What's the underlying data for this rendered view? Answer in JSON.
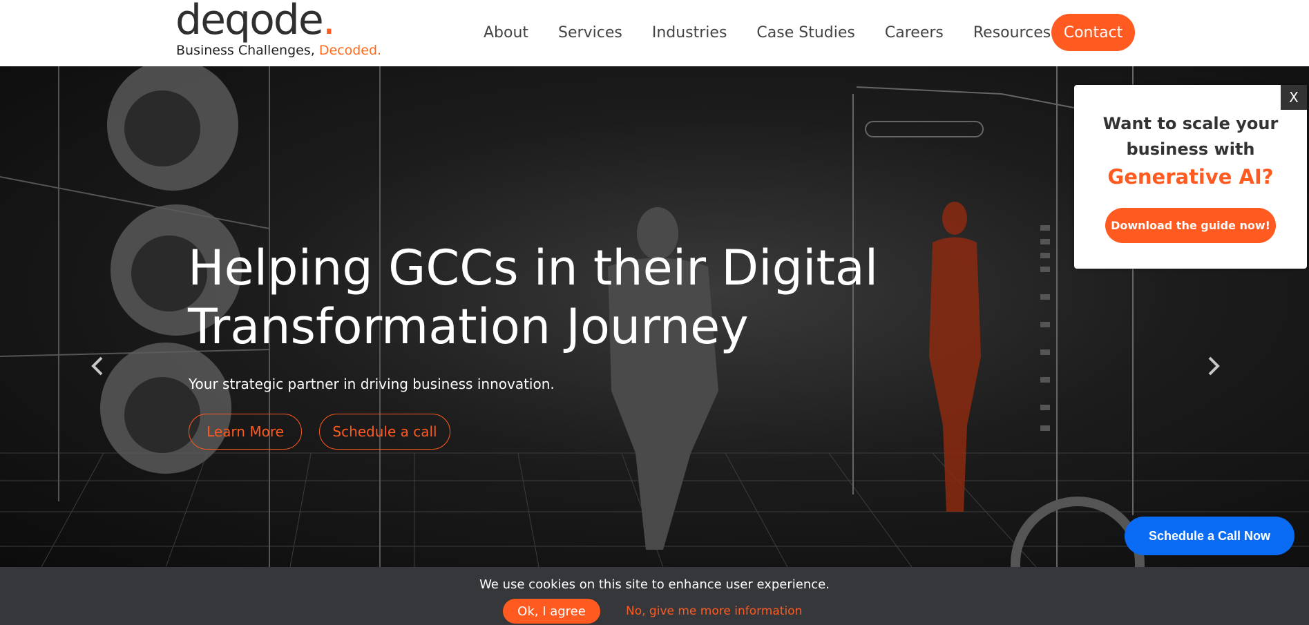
{
  "header": {
    "logo_word": "deqode",
    "logo_dot": ".",
    "tagline": "Business Challenges,",
    "tagline_accent": "Decoded.",
    "nav": [
      "About",
      "Services",
      "Industries",
      "Case Studies",
      "Careers",
      "Resources"
    ],
    "contact_label": "Contact"
  },
  "hero": {
    "title": "Helping GCCs in their Digital Transformation Journey",
    "subtitle": "Your strategic partner in driving business innovation.",
    "learn_more_label": "Learn More",
    "schedule_label": "Schedule a call",
    "prev_icon": "chevron-left-icon",
    "next_icon": "chevron-right-icon"
  },
  "popup": {
    "close_label": "X",
    "question": "Want to scale your business with",
    "accent": "Generative AI?",
    "button_label": "Download the guide now!"
  },
  "schedule_now_label": "Schedule a Call Now",
  "cookie": {
    "message": "We use cookies on this site to enhance user experience.",
    "ok_label": "Ok, I agree",
    "more_label": "No, give me more information"
  },
  "colors": {
    "accent": "#ff5a1f",
    "schedule_blue": "#0a6cf5",
    "cookie_bg": "#35373a"
  }
}
